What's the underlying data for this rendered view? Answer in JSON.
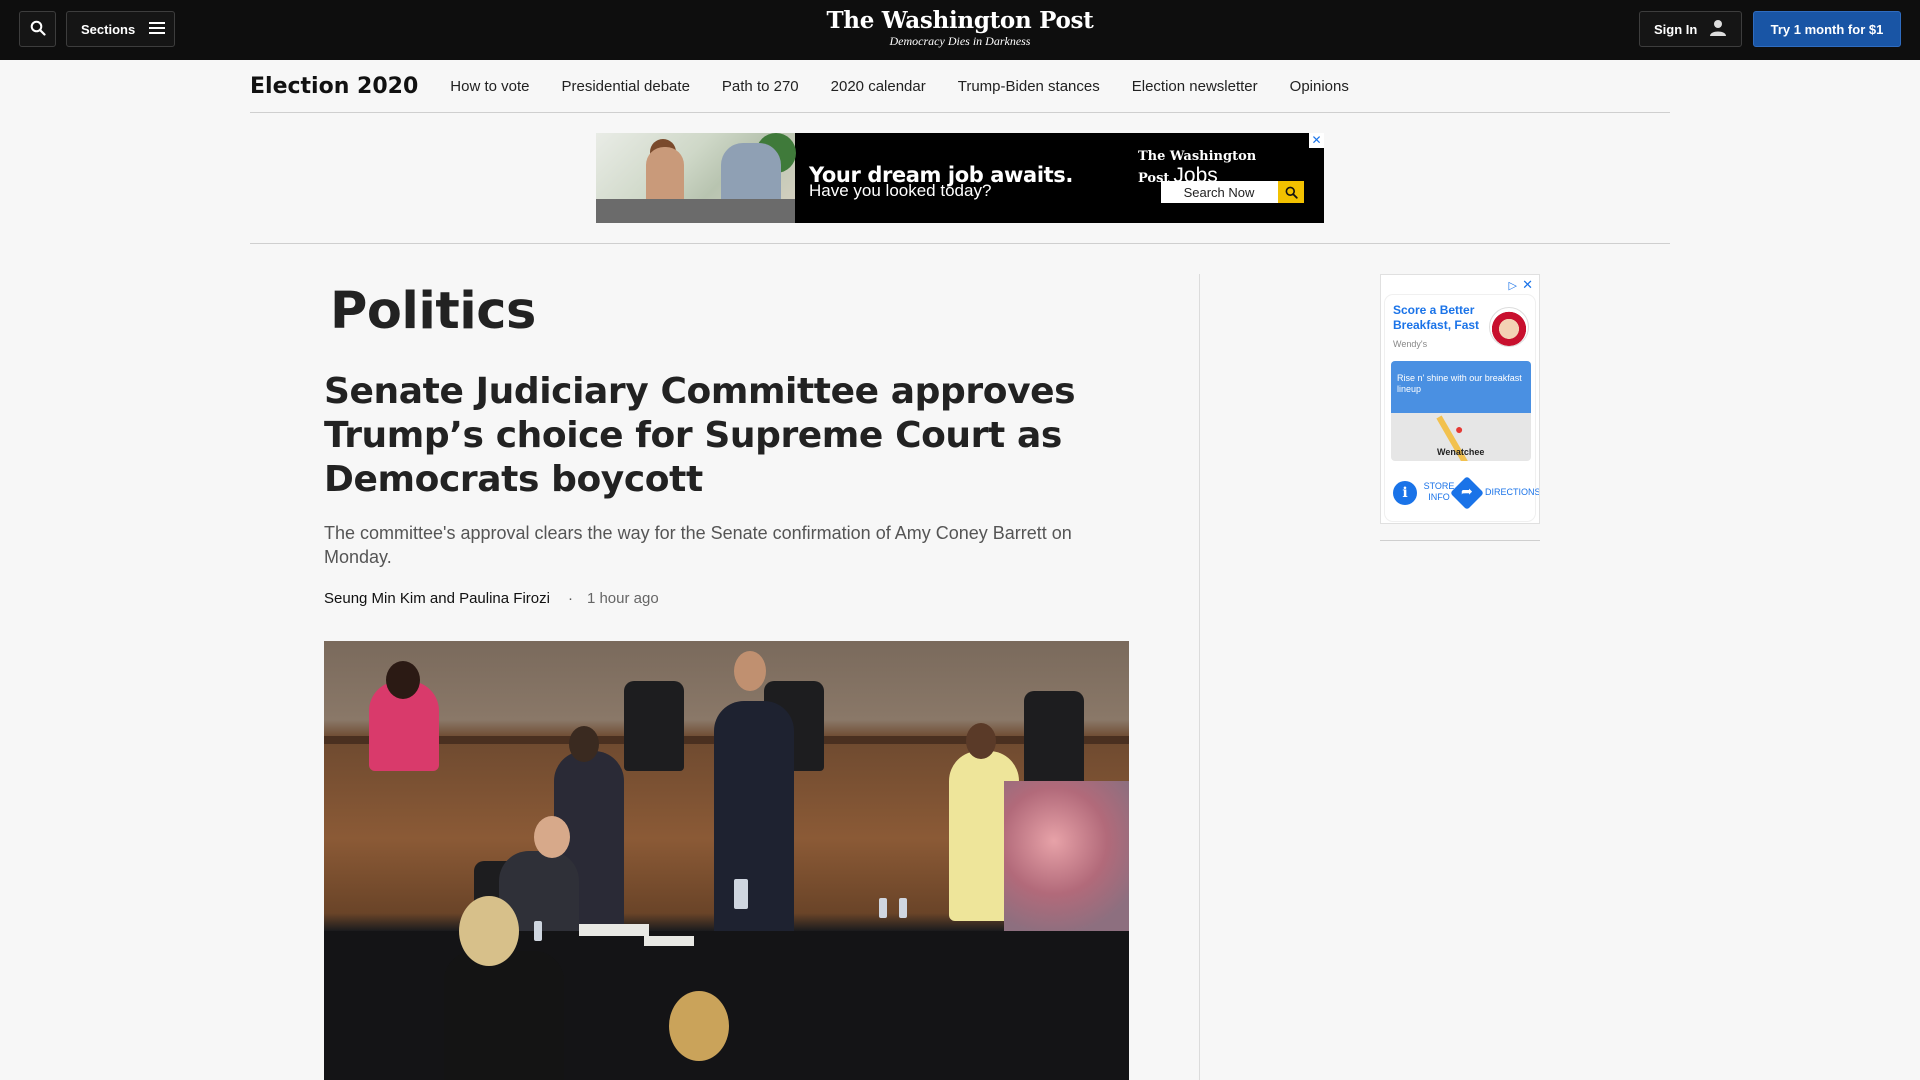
{
  "topbar": {
    "search_icon": "search-icon",
    "sections_label": "Sections",
    "sections_icon": "hamburger-menu-icon",
    "logo_name": "The Washington Post",
    "logo_tagline": "Democracy Dies in Darkness",
    "signin_label": "Sign In",
    "signin_icon": "user-icon",
    "trial_label": "Try 1 month for $1"
  },
  "subnav": {
    "title": "Election 2020",
    "items": [
      {
        "label": "How to vote"
      },
      {
        "label": "Presidential debate"
      },
      {
        "label": "Path to 270"
      },
      {
        "label": "2020 calendar"
      },
      {
        "label": "Trump-Biden stances"
      },
      {
        "label": "Election newsletter"
      },
      {
        "label": "Opinions"
      }
    ]
  },
  "banner_ad": {
    "headline": "Your dream job awaits.",
    "subline": "Have you looked today?",
    "brand": "The Washington Post",
    "brand_suffix": "Jobs",
    "search_label": "Search Now",
    "close": "✕"
  },
  "article": {
    "section": "Politics",
    "headline": "Senate Judiciary Committee approves Trump’s choice for Supreme Court as Democrats boycott",
    "dek": "The committee's approval clears the way for the Senate confirmation of Amy Coney Barrett on Monday.",
    "byline": "Seung Min Kim and Paulina Firozi",
    "separator": "·",
    "timestamp": "1 hour ago"
  },
  "side_ad": {
    "title": "Score a Better Breakfast, Fast",
    "brand": "Wendy's",
    "map_text": "Rise n' shine with our breakfast lineup",
    "map_label": "Wenatchee",
    "store_info": "STORE INFO",
    "directions": "DIRECTIONS",
    "adchoices": "▷",
    "close": "✕"
  },
  "colors": {
    "topbar_bg": "#0e0e0e",
    "trial_button": "#1955a5",
    "page_bg": "#f7f7f7",
    "ad_link_blue": "#1a73e8"
  }
}
